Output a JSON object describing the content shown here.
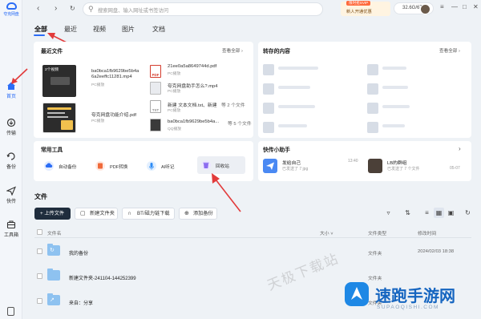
{
  "app": {
    "logo_text": "夸克网盘"
  },
  "colors": {
    "accent": "#2b6df6",
    "annotation_arrow": "#e23b3b",
    "folder": "#8ec2f0"
  },
  "rail": {
    "items": [
      {
        "label": "首页",
        "icon": "home-icon",
        "active": true
      },
      {
        "label": "传输",
        "icon": "transfer-icon"
      },
      {
        "label": "备份",
        "icon": "backup-icon"
      },
      {
        "label": "快传",
        "icon": "send-icon"
      },
      {
        "label": "工具箱",
        "icon": "toolbox-icon"
      }
    ]
  },
  "topbar": {
    "search_placeholder": "搜索网盘、输入网址或书签访问",
    "promo_badge": "限时抢SVIP",
    "promo_label": "新人开通优惠",
    "storage": "32.6G/6T"
  },
  "tabs": [
    "全部",
    "最近",
    "视频",
    "图片",
    "文档"
  ],
  "recent": {
    "title": "最近文件",
    "more": "查看全部",
    "items": [
      {
        "name": "ba0bca1fb9629be5b4a",
        "name2": "6a2eeffc11281.mp4",
        "sub": "PC播放",
        "overlay": "2个视频"
      },
      {
        "name": "21ee0a5a8649744d.pdf",
        "sub": "PC播放"
      },
      {
        "name": "夸克网盘助手怎么?.mp4",
        "sub": "PC播放"
      },
      {
        "name": "夸克网盘功能介绍.pdf",
        "sub": "PC播放"
      },
      {
        "name": "新建 文本文档.txt、新建",
        "name_tail": "等 2 个文件",
        "sub": "PC播放"
      },
      {
        "name": "ba0bca1fb9629be5b4a...",
        "name_tail": "等 5 个文件",
        "sub": "QQ播放"
      }
    ]
  },
  "saved": {
    "title": "转存的内容",
    "more": "查看全部"
  },
  "tools": {
    "title": "常用工具",
    "items": [
      {
        "label": "自动备份",
        "icon": "cloud-backup-icon",
        "color": "#2b6df6"
      },
      {
        "label": "PDF转换",
        "icon": "pdf-convert-icon",
        "color": "#f06a3a"
      },
      {
        "label": "AI听记",
        "icon": "microphone-icon",
        "color": "#2b8bf6"
      },
      {
        "label": "回收站",
        "icon": "trash-icon",
        "color": "#8c6cf0"
      }
    ]
  },
  "assistant": {
    "title": "快传小助手",
    "items": [
      {
        "name": "发给自己",
        "sub": "已发送了 7 jpg",
        "time": "13:40"
      },
      {
        "name": "LB的群组",
        "sub": "已发送了 7 个文件",
        "time": "05-07"
      }
    ]
  },
  "files": {
    "title": "文件",
    "buttons": {
      "upload": "+ 上传文件",
      "new_folder": "新建文件夹",
      "bt": "BT/磁力链下载",
      "add_backup": "添加备份"
    },
    "columns": {
      "name": "文件名",
      "size": "大小",
      "type": "文件类型",
      "modified": "修改时间"
    },
    "rows": [
      {
        "name": "我的备份",
        "type": "文件夹",
        "modified": "2024/02/03 18:38"
      },
      {
        "name": "新建文件夹-241104-144252399",
        "type": "文件夹",
        "modified": ""
      },
      {
        "name": "来自：分享",
        "type": "文件夹",
        "modified": ""
      }
    ]
  },
  "watermark": "天极下载站",
  "brand": {
    "name": "速跑手游网",
    "sub": "SUPAOQISHI.COM"
  }
}
